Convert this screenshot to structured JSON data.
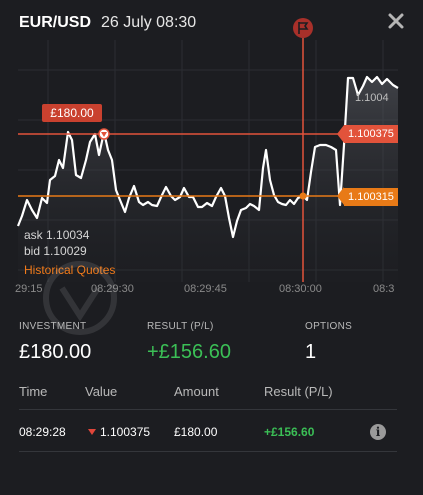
{
  "header": {
    "pair": "EUR/USD",
    "datetime": "26 July 08:30",
    "close_icon": "close-icon"
  },
  "chart": {
    "entry_tag": "£180.00",
    "right_tag_upper": "1.100375",
    "right_tag_lower": "1.100315",
    "price_label_top": "1.1004",
    "ask": "ask 1.10034",
    "bid": "bid 1.10029",
    "historical_quotes": "Historical Quotes",
    "x_ticks": [
      "29:15",
      "08:29:30",
      "08:29:45",
      "08:30:00",
      "08:3"
    ],
    "colors": {
      "line": "#ffffff",
      "upper_level": "#e2533b",
      "lower_level": "#e87a17",
      "accent": "#f07a1a"
    },
    "marker_icon": "flag-icon"
  },
  "stats": {
    "investment_label": "INVESTMENT",
    "investment_value": "£180.00",
    "result_label": "RESULT (P/L)",
    "result_value": "+£156.60",
    "options_label": "OPTIONS",
    "options_value": "1"
  },
  "table": {
    "headers": [
      "Time",
      "Value",
      "Amount",
      "Result (P/L)"
    ],
    "rows": [
      {
        "time": "08:29:28",
        "value": "1.100375",
        "amount": "£180.00",
        "result": "+£156.60",
        "direction": "down"
      }
    ]
  }
}
